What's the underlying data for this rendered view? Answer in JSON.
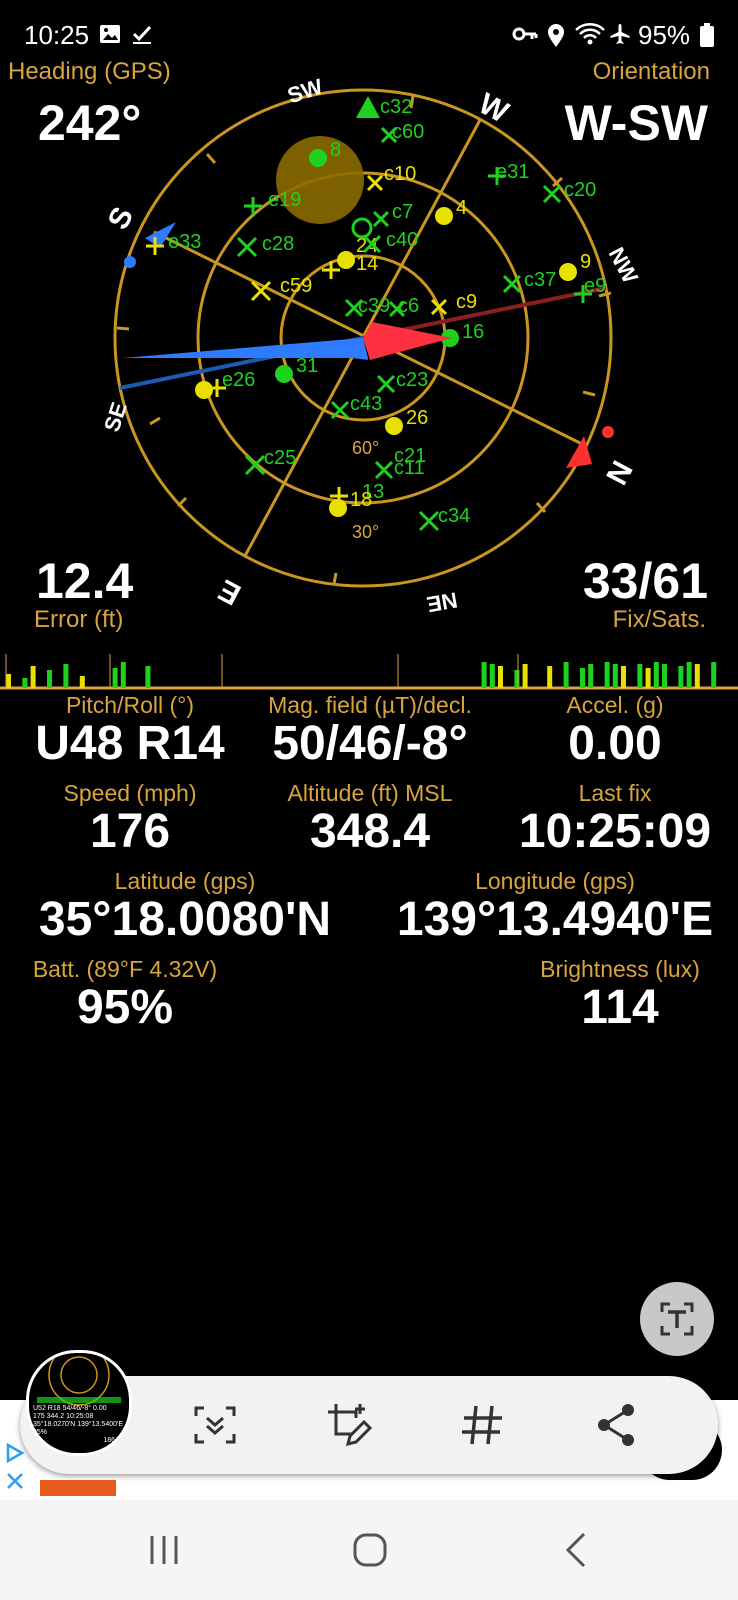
{
  "status_bar": {
    "time": "10:25",
    "battery_percent": "95%",
    "icons": [
      "gallery-icon",
      "check-icon",
      "key-icon",
      "location-icon",
      "wifi-icon",
      "airplane-icon",
      "battery-icon"
    ]
  },
  "header": {
    "heading_label": "Heading (GPS)",
    "heading_value": "242°",
    "orientation_label": "Orientation",
    "orientation_value": "W-SW"
  },
  "compass": {
    "directions": [
      "SW",
      "W",
      "NW",
      "N",
      "NE",
      "E",
      "SE",
      "S"
    ],
    "ring_labels": [
      "60°",
      "30°"
    ],
    "satellites": [
      "c32",
      "c60",
      "8",
      "c10",
      "e31",
      "c20",
      "e19",
      "c7",
      "4",
      "e33",
      "c28",
      "c40",
      "24",
      "14",
      "9",
      "c37",
      "e9",
      "c59",
      "c39",
      "c6",
      "c9",
      "16",
      "31",
      "26",
      "c23",
      "e26",
      "c43",
      "26",
      "c25",
      "c21",
      "c11",
      "18",
      "13",
      "c34"
    ]
  },
  "stats": {
    "error_value": "12.4",
    "error_label": "Error (ft)",
    "fix_value": "33/61",
    "fix_label": "Fix/Sats."
  },
  "grid": {
    "pitch_label": "Pitch/Roll (°)",
    "pitch_value": "U48 R14",
    "mag_label": "Mag. field (µT)/decl.",
    "mag_value": "50/46/-8°",
    "accel_label": "Accel. (g)",
    "accel_value": "0.00",
    "speed_label": "Speed (mph)",
    "speed_value": "176",
    "alt_label": "Altitude (ft) MSL",
    "alt_value": "348.4",
    "lastfix_label": "Last fix",
    "lastfix_value": "10:25:09",
    "lat_label": "Latitude (gps)",
    "lat_value": "35°18.0080'N",
    "lon_label": "Longitude (gps)",
    "lon_value": "139°13.4940'E",
    "batt_label": "Batt. (89°F 4.32V)",
    "batt_value": "95%",
    "bright_label": "Brightness (lux)",
    "bright_value": "114"
  },
  "thumbnail": {
    "line1": "U52 R18  54/46/-8°  0.00",
    "line2": "175   344.2  10:25:08",
    "line3": "35°18.0270'N  139°13.5400'E",
    "line4": "95%",
    "line5": "186"
  },
  "toolbar": {
    "icons": [
      "scroll-capture-icon",
      "crop-draw-icon",
      "hashtag-icon",
      "share-icon"
    ]
  },
  "ocr_button_icon": "text-extract-icon",
  "nav": {
    "icons": [
      "recents-icon",
      "home-icon",
      "back-icon"
    ]
  },
  "colors": {
    "accent_gold": "#d9a43c",
    "sat_green": "#1fd11f",
    "sat_yellow": "#e8e000",
    "needle_red": "#ff3030",
    "needle_blue": "#2e7bff"
  }
}
